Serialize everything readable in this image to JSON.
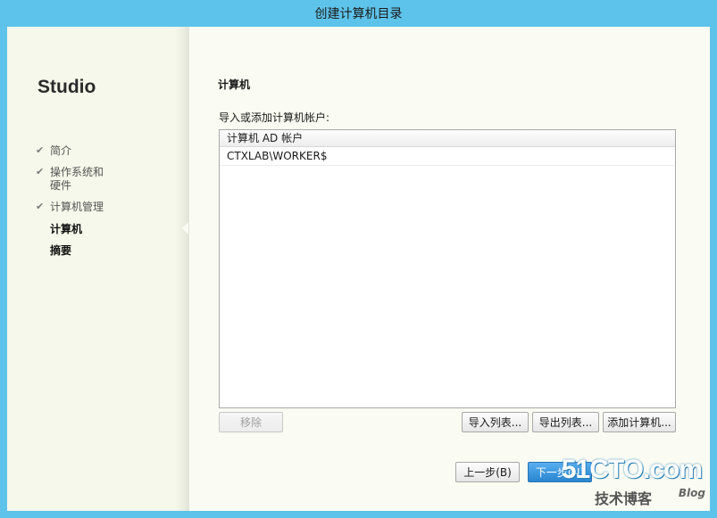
{
  "window": {
    "title": "创建计算机目录"
  },
  "sidebar": {
    "brand": "Studio",
    "steps": [
      {
        "label": "简介",
        "state": "done"
      },
      {
        "label": "操作系统和\n硬件",
        "state": "done"
      },
      {
        "label": "计算机管理",
        "state": "done"
      },
      {
        "label": "计算机",
        "state": "current"
      },
      {
        "label": "摘要",
        "state": "pending"
      }
    ],
    "check_icon": "✔"
  },
  "main": {
    "section_title": "计算机",
    "prompt": "导入或添加计算机帐户:",
    "table": {
      "column_header": "计算机 AD 帐户",
      "rows": [
        "CTXLAB\\WORKER$"
      ]
    },
    "buttons": {
      "remove": "移除",
      "import_list": "导入列表...",
      "export_list": "导出列表...",
      "add_computers": "添加计算机..."
    }
  },
  "footer": {
    "back": "上一步(B)",
    "next": "下一步(N)"
  },
  "watermark": {
    "logo": "51CTO.com",
    "subtitle": "技术博客",
    "blog": "Blog"
  },
  "colors": {
    "title_bar": "#5ec3ea",
    "primary_button": "#2a86d0"
  }
}
